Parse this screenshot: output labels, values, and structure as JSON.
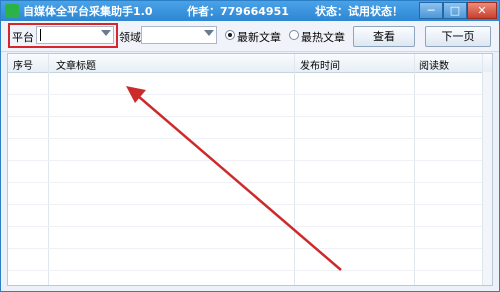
{
  "titlebar": {
    "app_name": "自媒体全平台采集助手1.0",
    "author": "作者：779664951",
    "status": "状态：试用状态！",
    "minimize": "─",
    "maximize": "□",
    "close": "✕"
  },
  "toolbar": {
    "platform_label": "平台",
    "platform_value": "",
    "domain_label": "领域",
    "domain_value": "",
    "sort_options": [
      {
        "label": "最新文章",
        "selected": true
      },
      {
        "label": "最热文章",
        "selected": false
      }
    ],
    "view_button": "查看",
    "next_page_button": "下一页"
  },
  "table": {
    "columns": [
      "序号",
      "文章标题",
      "发布时间",
      "阅读数"
    ],
    "rows": []
  },
  "colors": {
    "titlebar": "#2d86d2",
    "highlight_box": "#d6262c",
    "annotation_arrow": "#cc2b2b"
  }
}
